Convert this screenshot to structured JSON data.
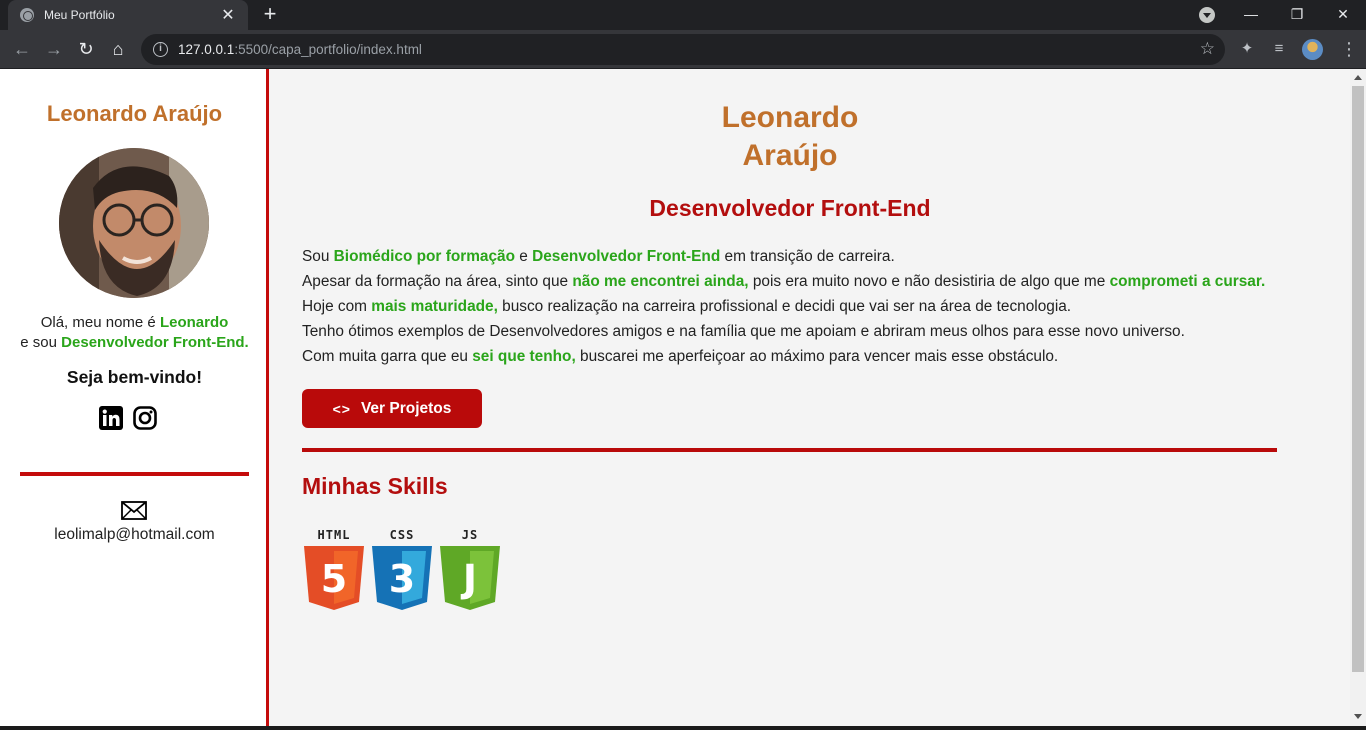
{
  "browser": {
    "tab_title": "Meu Portfólio",
    "tab_close": "✕",
    "new_tab": "+",
    "url_host": "127.0.0.1",
    "url_rest": ":5500/capa_portfolio/index.html",
    "window_minimize": "—",
    "window_restore": "❐",
    "window_close": "✕"
  },
  "sidebar": {
    "name": "Leonardo Araújo",
    "intro_prefix": "Olá, meu nome é ",
    "intro_name": "Leonardo",
    "intro_mid": "e sou ",
    "intro_role": "Desenvolvedor Front-End.",
    "welcome": "Seja bem-vindo!",
    "email": "leolimalp@hotmail.com",
    "socials": [
      "linkedin-icon",
      "instagram-icon"
    ]
  },
  "main": {
    "title_line1": "Leonardo",
    "title_line2": "Araújo",
    "role": "Desenvolvedor Front-End",
    "bio": {
      "l1_a": "Sou ",
      "l1_b": "Biomédico por formação",
      "l1_c": " e ",
      "l1_d": "Desenvolvedor Front-End",
      "l1_e": " em transição de carreira.",
      "l2_a": "Apesar da formação na área, sinto que ",
      "l2_b": "não me encontrei ainda,",
      "l2_c": " pois era muito novo e não desistiria de algo que me ",
      "l2_d": "comprometi a cursar.",
      "l3_a": "Hoje com ",
      "l3_b": "mais maturidade,",
      "l3_c": " busco realização na carreira profissional e decidi que vai ser na área de tecnologia.",
      "l4": "Tenho ótimos exemplos de Desenvolvedores amigos e na família que me apoiam e abriram meus olhos para esse novo universo.",
      "l5_a": "Com muita garra que eu ",
      "l5_b": "sei que tenho,",
      "l5_c": " buscarei me aperfeiçoar ao máximo para vencer mais esse obstáculo."
    },
    "button_icon": "<>",
    "button_label": "Ver Projetos",
    "skills_title": "Minhas Skills",
    "skills": [
      {
        "label": "HTML",
        "number": "5",
        "color": "#e44d26"
      },
      {
        "label": "CSS",
        "number": "3",
        "color": "#1572b6"
      },
      {
        "label": "JS",
        "number": "J",
        "color": "#5fa826"
      }
    ]
  },
  "colors": {
    "accent_red": "#b90a0a",
    "name_orange": "#c0702b",
    "highlight_green": "#2aa51a"
  }
}
